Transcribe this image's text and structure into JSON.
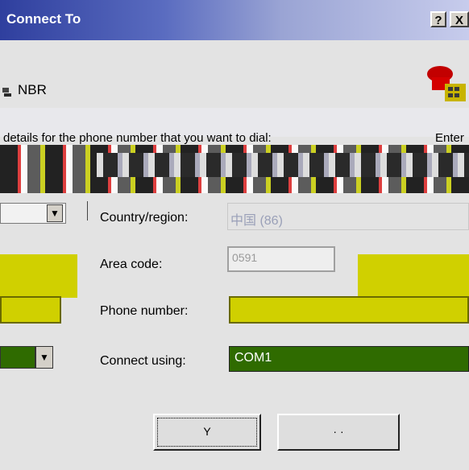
{
  "window": {
    "title": "Connect To",
    "help_label": "?",
    "close_label": "X"
  },
  "connection": {
    "name": "NBR"
  },
  "instruction": {
    "text": "details for the phone number that you want to dial:",
    "text_right": "Enter"
  },
  "fields": {
    "country_label": "Country/region:",
    "country_value": "中国 (86)",
    "area_label": "Area code:",
    "area_value": "0591",
    "phone_label": "Phone number:",
    "phone_value": "",
    "connect_label": "Connect using:",
    "connect_value": "COM1"
  },
  "buttons": {
    "dial_label": "Y",
    "cancel_label": "· ·"
  },
  "icons": {
    "dropdown": "▼",
    "connection": "connection-icon",
    "phone": "telephone-icon"
  },
  "colors": {
    "titlebar_start": "#2f3f9e",
    "field_highlight": "#d0d000",
    "combo_selected": "#2f6b00"
  }
}
